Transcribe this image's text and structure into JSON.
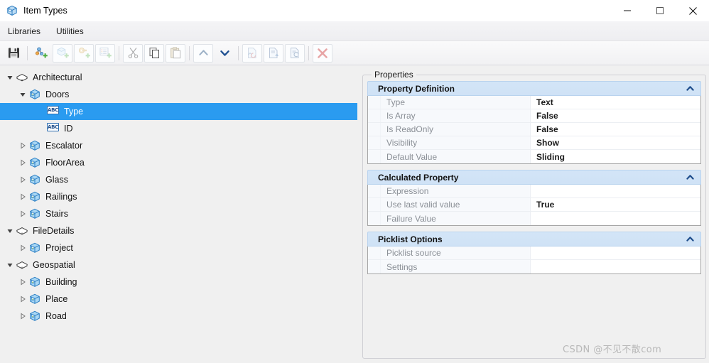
{
  "window": {
    "title": "Item Types",
    "icon": "cube-icon",
    "controls": [
      {
        "name": "minimize-button",
        "glyph": "minimize-icon"
      },
      {
        "name": "maximize-button",
        "glyph": "maximize-icon"
      },
      {
        "name": "close-button",
        "glyph": "close-icon"
      }
    ]
  },
  "menubar": {
    "items": [
      {
        "label": "Libraries",
        "name": "menu-libraries"
      },
      {
        "label": "Utilities",
        "name": "menu-utilities"
      }
    ]
  },
  "toolbar": {
    "buttons": [
      {
        "name": "save-button",
        "icon": "save-floppy-icon",
        "enabled": true,
        "framed": false
      },
      {
        "name": "add-library-button",
        "icon": "add-library-icon",
        "enabled": true,
        "framed": false
      },
      {
        "name": "add-item-type-button",
        "icon": "add-cube-icon",
        "enabled": false,
        "framed": true
      },
      {
        "name": "add-property-button",
        "icon": "add-property-icon",
        "enabled": false,
        "framed": true
      },
      {
        "name": "add-picklist-button",
        "icon": "add-list-icon",
        "enabled": false,
        "framed": true
      },
      {
        "name": "cut-button",
        "icon": "scissors-icon",
        "enabled": false,
        "framed": true
      },
      {
        "name": "copy-button",
        "icon": "copy-pages-icon",
        "enabled": true,
        "framed": true
      },
      {
        "name": "paste-button",
        "icon": "clipboard-icon",
        "enabled": false,
        "framed": true
      },
      {
        "name": "move-up-button",
        "icon": "chevron-up-icon",
        "enabled": false,
        "framed": true
      },
      {
        "name": "move-down-button",
        "icon": "chevron-down-icon",
        "enabled": true,
        "framed": false
      },
      {
        "name": "import-button",
        "icon": "document-disabled-icon",
        "enabled": false,
        "framed": true
      },
      {
        "name": "export-button",
        "icon": "document-arrow-icon",
        "enabled": false,
        "framed": true
      },
      {
        "name": "refresh-button",
        "icon": "document-refresh-icon",
        "enabled": false,
        "framed": true
      },
      {
        "name": "delete-button",
        "icon": "red-x-icon",
        "enabled": false,
        "framed": true
      }
    ]
  },
  "tree": {
    "nodes": [
      {
        "label": "Architectural",
        "icon": "library-icon",
        "indent": 0,
        "expander": "expanded",
        "selected": false
      },
      {
        "label": "Doors",
        "icon": "cube-icon",
        "indent": 1,
        "expander": "expanded",
        "selected": false
      },
      {
        "label": "Type",
        "icon": "abc-icon",
        "indent": 2,
        "expander": "none",
        "selected": true
      },
      {
        "label": "ID",
        "icon": "abc-icon",
        "indent": 2,
        "expander": "none",
        "selected": false
      },
      {
        "label": "Escalator",
        "icon": "cube-icon",
        "indent": 1,
        "expander": "collapsed",
        "selected": false
      },
      {
        "label": "FloorArea",
        "icon": "cube-icon",
        "indent": 1,
        "expander": "collapsed",
        "selected": false
      },
      {
        "label": "Glass",
        "icon": "cube-icon",
        "indent": 1,
        "expander": "collapsed",
        "selected": false
      },
      {
        "label": "Railings",
        "icon": "cube-icon",
        "indent": 1,
        "expander": "collapsed",
        "selected": false
      },
      {
        "label": "Stairs",
        "icon": "cube-icon",
        "indent": 1,
        "expander": "collapsed",
        "selected": false
      },
      {
        "label": "FileDetails",
        "icon": "library-icon",
        "indent": 0,
        "expander": "expanded",
        "selected": false
      },
      {
        "label": "Project",
        "icon": "cube-icon",
        "indent": 1,
        "expander": "collapsed",
        "selected": false
      },
      {
        "label": "Geospatial",
        "icon": "library-icon",
        "indent": 0,
        "expander": "expanded",
        "selected": false
      },
      {
        "label": "Building",
        "icon": "cube-icon",
        "indent": 1,
        "expander": "collapsed",
        "selected": false
      },
      {
        "label": "Place",
        "icon": "cube-icon",
        "indent": 1,
        "expander": "collapsed",
        "selected": false
      },
      {
        "label": "Road",
        "icon": "cube-icon",
        "indent": 1,
        "expander": "collapsed",
        "selected": false
      }
    ]
  },
  "properties": {
    "legend": "Properties",
    "sections": [
      {
        "title": "Property Definition",
        "collapse_icon": "chevron-up-icon",
        "rows": [
          {
            "key": "Type",
            "value": "Text"
          },
          {
            "key": "Is Array",
            "value": "False"
          },
          {
            "key": "Is ReadOnly",
            "value": "False"
          },
          {
            "key": "Visibility",
            "value": "Show"
          },
          {
            "key": "Default Value",
            "value": "Sliding"
          }
        ]
      },
      {
        "title": "Calculated Property",
        "collapse_icon": "chevron-up-icon",
        "rows": [
          {
            "key": "Expression",
            "value": ""
          },
          {
            "key": "Use last valid value",
            "value": "True"
          },
          {
            "key": "Failure Value",
            "value": ""
          }
        ]
      },
      {
        "title": "Picklist Options",
        "collapse_icon": "chevron-up-icon",
        "rows": [
          {
            "key": "Picklist source",
            "value": ""
          },
          {
            "key": "Settings",
            "value": ""
          }
        ]
      }
    ]
  },
  "watermark": {
    "text": "CSDN @不见不散com"
  },
  "colors": {
    "selection": "#2a9bf0",
    "section_header": "#cfe2f6",
    "pane_background": "#f0f0f0"
  }
}
